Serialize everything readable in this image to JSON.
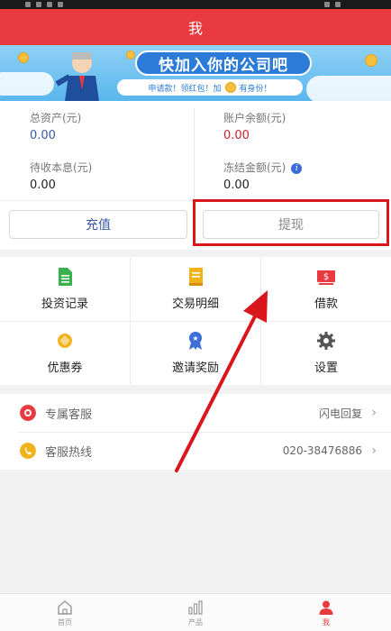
{
  "header": {
    "title": "我"
  },
  "banner": {
    "headline": "快加入你的公司吧",
    "subline_left": "申请款！领红包！加",
    "subline_right": "有身份！"
  },
  "stats": [
    {
      "label": "总资产(元)",
      "value": "0.00",
      "color": "#3a58a8"
    },
    {
      "label": "账户余额(元)",
      "value": "0.00",
      "color": "#c8242f"
    },
    {
      "label": "待收本息(元)",
      "value": "0.00",
      "color": "#222222"
    },
    {
      "label": "冻结金额(元)",
      "value": "0.00",
      "color": "#222222",
      "info_icon": "info-icon"
    }
  ],
  "actions": {
    "recharge_label": "充值",
    "withdraw_label": "提现"
  },
  "grid": [
    {
      "label": "投资记录",
      "icon": "document-icon"
    },
    {
      "label": "交易明细",
      "icon": "ledger-icon"
    },
    {
      "label": "借款",
      "icon": "money-icon"
    },
    {
      "label": "优惠券",
      "icon": "coupon-icon"
    },
    {
      "label": "邀请奖励",
      "icon": "medal-icon"
    },
    {
      "label": "设置",
      "icon": "gear-icon"
    }
  ],
  "list": [
    {
      "label": "专属客服",
      "value": "闪电回复",
      "icon": "service-icon"
    },
    {
      "label": "客服热线",
      "value": "020-38476886",
      "icon": "phone-icon"
    }
  ],
  "tabbar": [
    {
      "label": "首页",
      "icon": "home-icon",
      "active": false
    },
    {
      "label": "产品",
      "icon": "chart-icon",
      "active": false
    },
    {
      "label": "我",
      "icon": "user-icon",
      "active": true
    }
  ],
  "colors": {
    "brand_red": "#e83a3f",
    "link_blue": "#3a58a8",
    "annotation_red": "#d9161c"
  }
}
